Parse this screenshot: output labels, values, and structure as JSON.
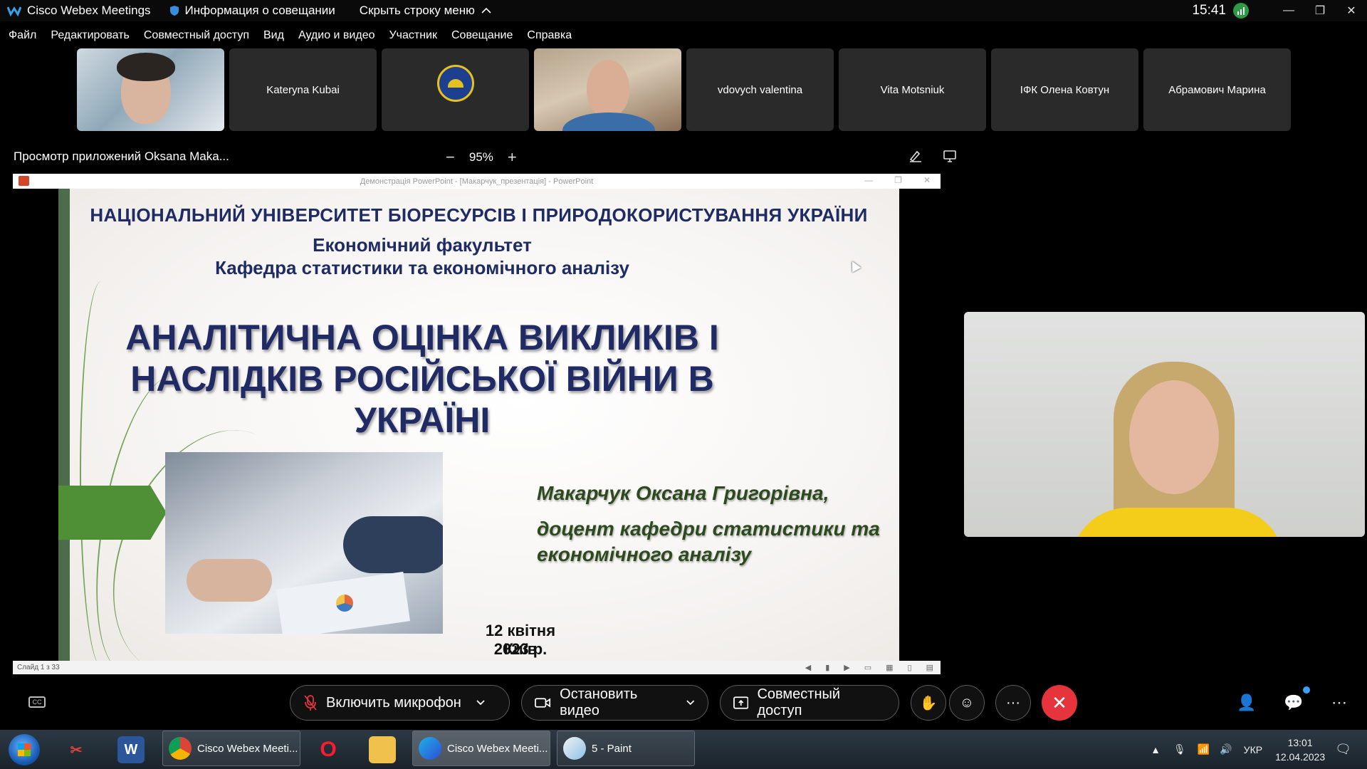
{
  "titlebar": {
    "app_name": "Cisco Webex Meetings",
    "meeting_info": "Информация о совещании",
    "hide_menu": "Скрыть строку меню",
    "time": "15:41"
  },
  "menu": {
    "items": [
      "Файл",
      "Редактировать",
      "Совместный доступ",
      "Вид",
      "Аудио и видео",
      "Участник",
      "Совещание",
      "Справка"
    ]
  },
  "participants": [
    "Kateryna Kubai",
    "vdovych valentina",
    "Vita Motsniuk",
    "ІФК Олена Ковтун",
    "Абрамович Марина"
  ],
  "share": {
    "title": "Просмотр приложений Oksana Maka...",
    "zoom": "95%",
    "ppt_window_title": "Демонстрація PowerPoint - [Макарчук_презентація] - PowerPoint",
    "slide_counter": "Слайд 1 з 33"
  },
  "slide": {
    "university": "НАЦІОНАЛЬНИЙ УНІВЕРСИТЕТ БІОРЕСУРСІВ І ПРИРОДОКОРИСТУВАННЯ УКРАЇНИ",
    "faculty": "Економічний факультет",
    "department": "Кафедра статистики та економічного аналізу",
    "title_line1": "АНАЛІТИЧНА ОЦІНКА ВИКЛИКІВ І",
    "title_line2": "НАСЛІДКІВ РОСІЙСЬКОЇ ВІЙНИ В",
    "title_line3": "УКРАЇНІ",
    "author": "Макарчук Оксана Григорівна,",
    "position_line1": "доцент кафедри статистики та",
    "position_line2": "економічного аналізу",
    "date": "12 квітня 2023 р.",
    "city": "Київ"
  },
  "controls": {
    "mic": "Включить микрофон",
    "video": "Остановить видео",
    "share": "Совместный доступ"
  },
  "taskbar": {
    "tasks": [
      "Cisco Webex Meeti...",
      "Cisco Webex Meeti...",
      "5 - Paint"
    ],
    "lang": "УКР",
    "time": "13:01",
    "date": "12.04.2023"
  },
  "colors": {
    "end_call": "#e5343c",
    "slide_title": "#202a64",
    "slide_green": "#4f8f36"
  }
}
